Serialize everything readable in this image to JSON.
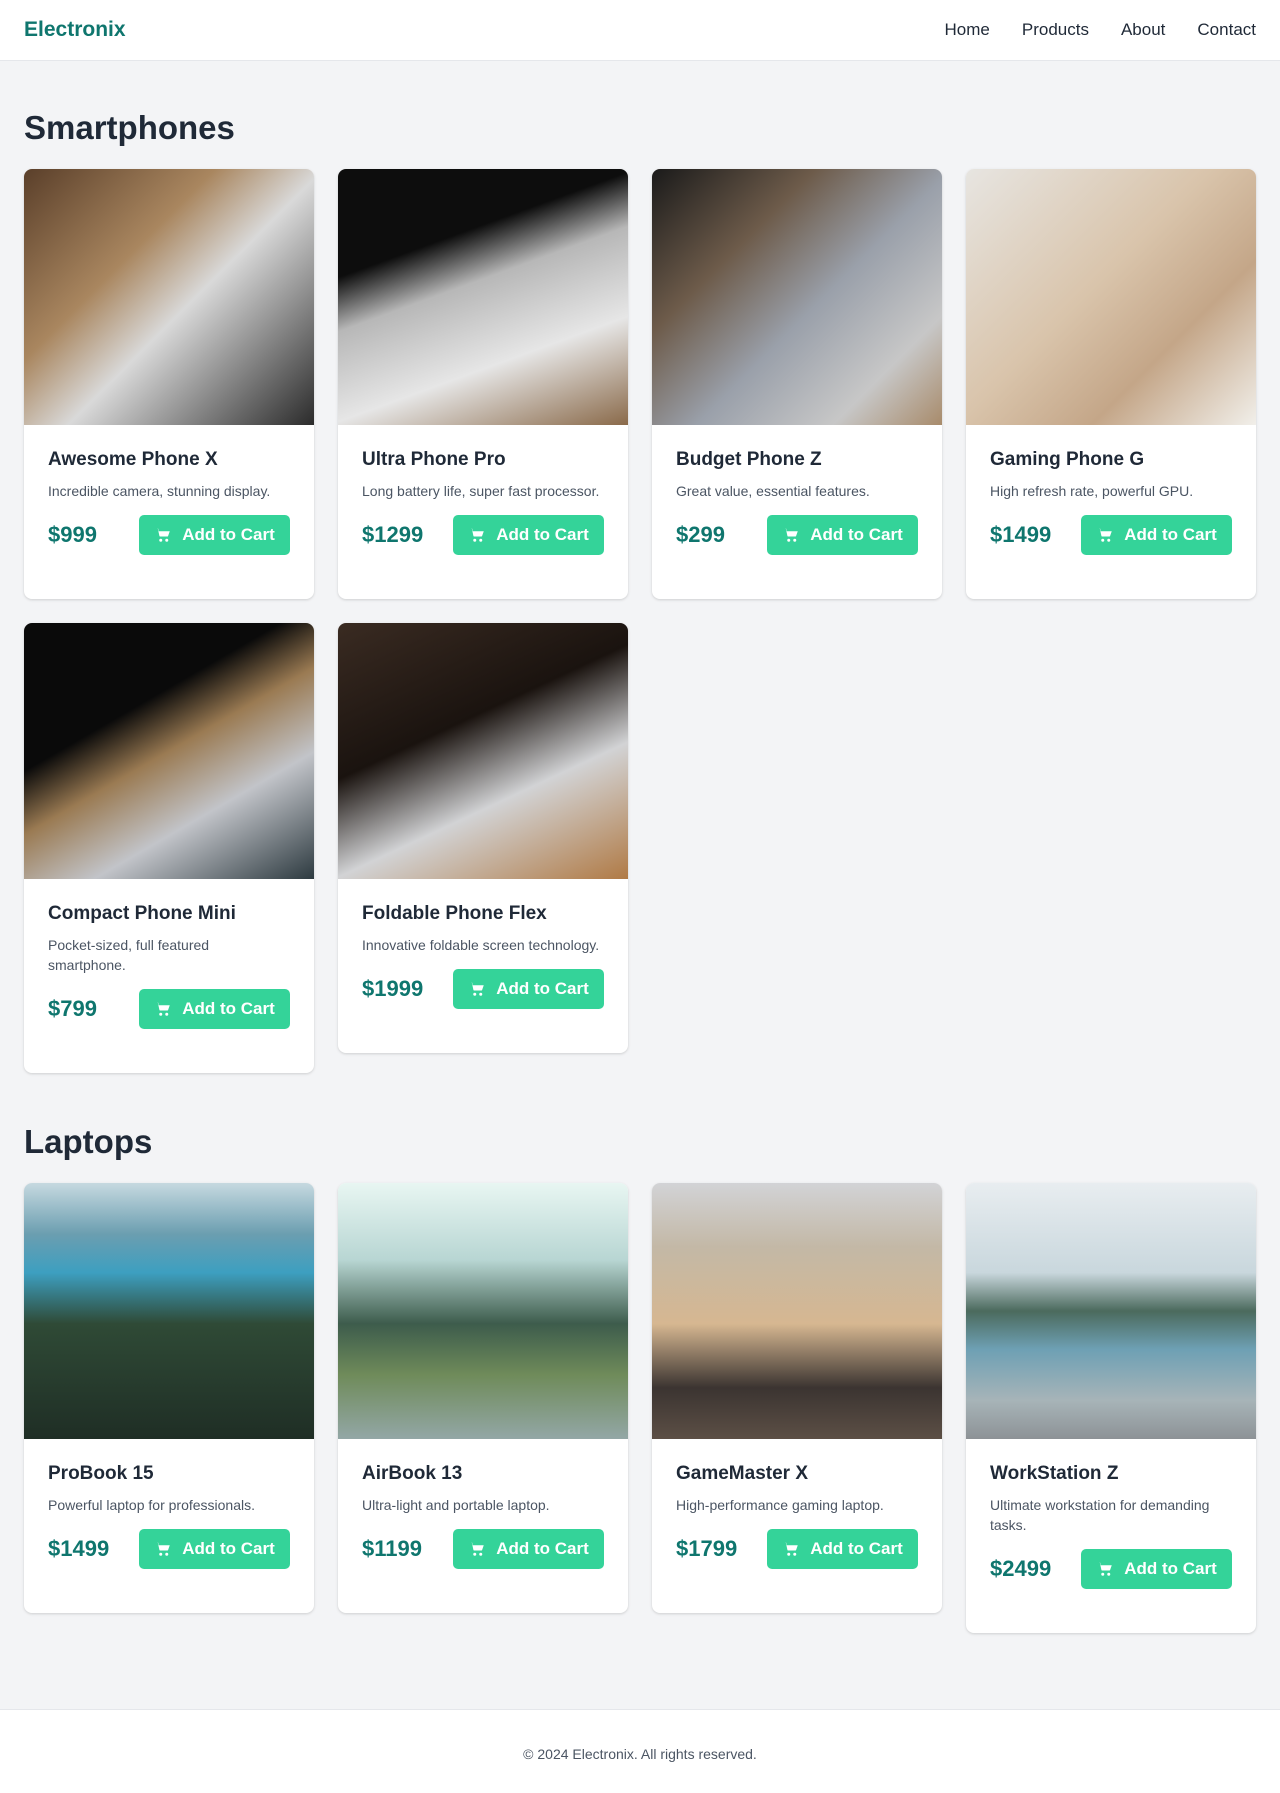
{
  "brand": "Electronix",
  "nav": [
    "Home",
    "Products",
    "About",
    "Contact"
  ],
  "sections": [
    {
      "title": "Smartphones",
      "products": [
        {
          "name": "Awesome Phone X",
          "desc": "Incredible camera, stunning display.",
          "price": "$999",
          "cta": "Add to Cart",
          "photo": "laptop-typing-photo"
        },
        {
          "name": "Ultra Phone Pro",
          "desc": "Long battery life, super fast processor.",
          "price": "$1299",
          "cta": "Add to Cart",
          "photo": "laptop-coffee-photo"
        },
        {
          "name": "Budget Phone Z",
          "desc": "Great value, essential features.",
          "price": "$299",
          "cta": "Add to Cart",
          "photo": "phone-in-hand-photo"
        },
        {
          "name": "Gaming Phone G",
          "desc": "High refresh rate, powerful GPU.",
          "price": "$1499",
          "cta": "Add to Cart",
          "photo": "hands-writing-photo"
        },
        {
          "name": "Compact Phone Mini",
          "desc": "Pocket-sized, full featured smartphone.",
          "price": "$799",
          "cta": "Add to Cart",
          "photo": "laptop-keyboard-photo"
        },
        {
          "name": "Foldable Phone Flex",
          "desc": "Innovative foldable screen technology.",
          "price": "$1999",
          "cta": "Add to Cart",
          "photo": "open-laptop-photo"
        }
      ]
    },
    {
      "title": "Laptops",
      "products": [
        {
          "name": "ProBook 15",
          "desc": "Powerful laptop for professionals.",
          "price": "$1499",
          "cta": "Add to Cart",
          "photo": "forest-lake-photo"
        },
        {
          "name": "AirBook 13",
          "desc": "Ultra-light and portable laptop.",
          "price": "$1199",
          "cta": "Add to Cart",
          "photo": "misty-valley-photo"
        },
        {
          "name": "GameMaster X",
          "desc": "High-performance gaming laptop.",
          "price": "$1799",
          "cta": "Add to Cart",
          "photo": "beach-rocks-photo"
        },
        {
          "name": "WorkStation Z",
          "desc": "Ultimate workstation for demanding tasks.",
          "price": "$2499",
          "cta": "Add to Cart",
          "photo": "pebble-shore-photo"
        }
      ]
    }
  ],
  "footer": "© 2024 Electronix. All rights reserved.",
  "colors": {
    "brand": "#0f766e",
    "price": "#0f766e",
    "button": "#34d399",
    "background": "#f3f4f6"
  },
  "icons": {
    "cart": "cart-icon"
  }
}
